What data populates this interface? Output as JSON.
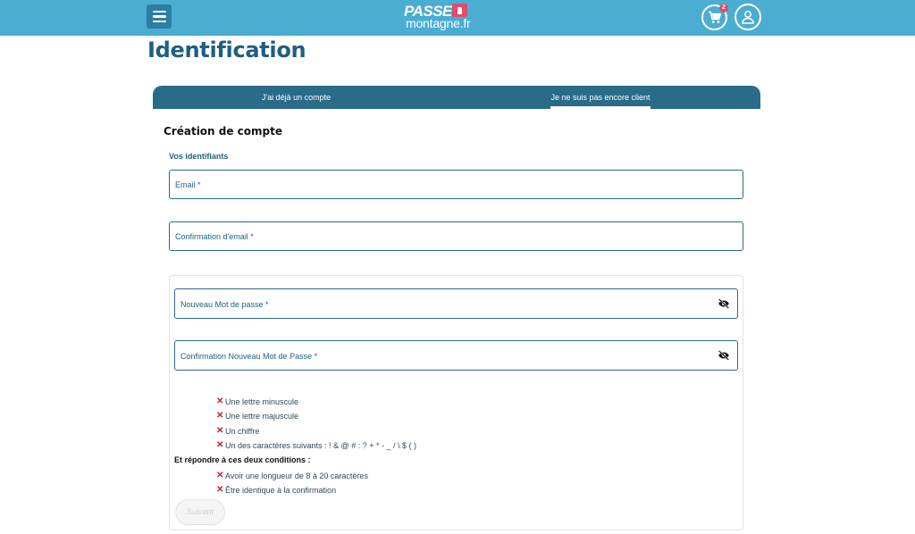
{
  "header": {
    "logo_top": "PASSE",
    "logo_bottom": "montagne.fr",
    "cart_count": "2",
    "colors": {
      "bar": "#4aadd1",
      "accent": "#e24b6a"
    }
  },
  "page": {
    "title": "Identification"
  },
  "tabs": [
    {
      "label": "J'ai déjà un compte",
      "active": false
    },
    {
      "label": "Je ne suis pas encore client",
      "active": true
    }
  ],
  "form": {
    "section_title": "Création de compte",
    "subsection_title": "Vos identifiants",
    "email_label": "Email *",
    "email_confirm_label": "Confirmation d'email *",
    "password_label": "Nouveau Mot de passe *",
    "password_confirm_label": "Confirmation Nouveau Mot de Passe *",
    "rules": [
      "Une lettre minuscule",
      "Une lettre majuscule",
      "Un chiffre",
      "Un des caractères suivants : ! & @ # : ? + * - _ / \\ $ ( )"
    ],
    "conditions_heading": "Et répondre à ces deux conditions :",
    "conditions": [
      "Avoir une longueur de 8 à 20 caractères",
      "Être identique à la confirmation"
    ],
    "rule_status_icon": "cross-icon",
    "submit_label": "Suivant"
  }
}
